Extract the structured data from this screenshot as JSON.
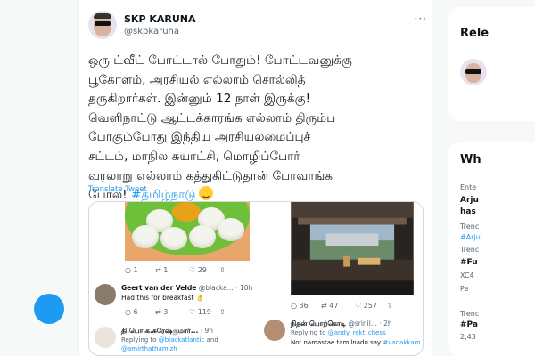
{
  "tweet": {
    "display_name": "SKP KARUNA",
    "handle": "@skpkaruna",
    "more": "···",
    "lines": [
      "ஒரு ட்வீட் போட்டால் போதும்! போட்டவனுக்கு",
      "பூகோளம், அரசியல் எல்லாம் சொல்லித்",
      "தருகிறார்கள். இன்னும் 12 நாள் இருக்கு!",
      "வெளிநாட்டு ஆட்டக்காரங்க எல்லாம் திரும்ப",
      "போகும்போது இந்திய அரசியலமைப்புச்",
      "சட்டம், மாநில சுயாட்சி, மொழிப்போர்",
      "வரலாறு எல்லாம் கத்துகிட்டுதான் போவாங்க"
    ],
    "last_line": "போல!",
    "hashtag": "#தமிழ்நாடு",
    "translate": "Translate Tweet"
  },
  "media_left": {
    "actions": [
      "1",
      "1",
      "29",
      ""
    ],
    "reply1": {
      "name": "Geert van der Velde",
      "handle": "@blacka...",
      "time": "· 10h",
      "text": "Had this for breakfast 👌",
      "actions": [
        "6",
        "3",
        "119",
        ""
      ]
    },
    "reply2": {
      "name": "தி.பொ.க.சுரேஷ்குமார்...",
      "time": "· 9h",
      "replying": "Replying to ",
      "mention1": "@blackatlantic",
      "and": " and",
      "mention2": "@amirthathamizh"
    }
  },
  "media_right": {
    "actions": [
      "36",
      "47",
      "257",
      ""
    ],
    "reply": {
      "name": "நிதன் பொற்கொடி",
      "handle": "@srinil...",
      "time": "· 2h",
      "replying": "Replying to ",
      "mention": "@andy_rekt_chess",
      "text": "Not namastae tamilnadu say ",
      "hashtag": "#vanakkam"
    }
  },
  "sidebar": {
    "relevant_title": "Rele",
    "whats_title": "Wh",
    "items": [
      {
        "small": "Ente",
        "strong1": "Arju",
        "strong2": "has"
      },
      {
        "small": "Trenc",
        "blue": "#Arju"
      },
      {
        "small": "Trenc",
        "strong1": "#Fu",
        "sub": "XC4",
        "sub2": "Pe"
      },
      {
        "small": "Trenc",
        "strong1": "#Pa",
        "sub": "2,43"
      }
    ]
  }
}
